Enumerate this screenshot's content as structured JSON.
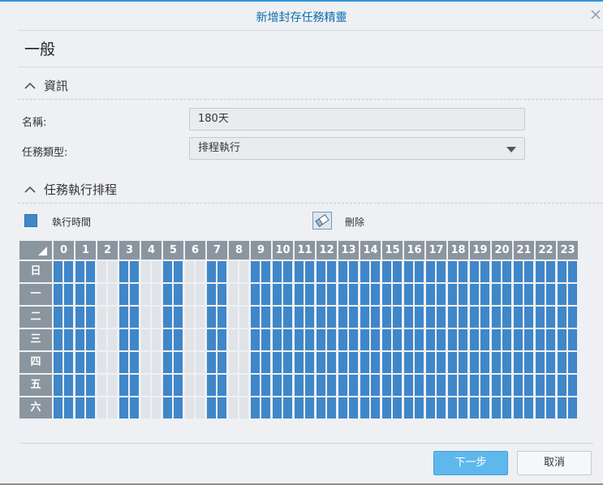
{
  "window": {
    "title": "新增封存任務精靈"
  },
  "heading": "一般",
  "info_section": {
    "label": "資訊"
  },
  "form": {
    "name_label": "名稱:",
    "name_value": "180天",
    "type_label": "任務類型:",
    "type_value": "排程執行"
  },
  "schedule_section": {
    "label": "任務執行排程"
  },
  "legend": {
    "run_label": "執行時間",
    "delete_label": "刪除",
    "run_color": "#3f87c9",
    "off_color": "#e0e3e7"
  },
  "schedule": {
    "hours": [
      "0",
      "1",
      "2",
      "3",
      "4",
      "5",
      "6",
      "7",
      "8",
      "9",
      "10",
      "11",
      "12",
      "13",
      "14",
      "15",
      "16",
      "17",
      "18",
      "19",
      "20",
      "21",
      "22",
      "23"
    ],
    "days": [
      "日",
      "一",
      "二",
      "三",
      "四",
      "五",
      "六"
    ],
    "active_hours": [
      0,
      1,
      3,
      5,
      7,
      9,
      10,
      11,
      12,
      13,
      14,
      15,
      16,
      17,
      18,
      19,
      20,
      21,
      22,
      23
    ]
  },
  "buttons": {
    "next": "下一步",
    "cancel": "取消"
  },
  "icons": {
    "close": "close-icon",
    "collapse": "chevron-up-icon",
    "dropdown": "caret-down-icon",
    "eraser": "eraser-icon",
    "corner": "triangle-icon"
  }
}
